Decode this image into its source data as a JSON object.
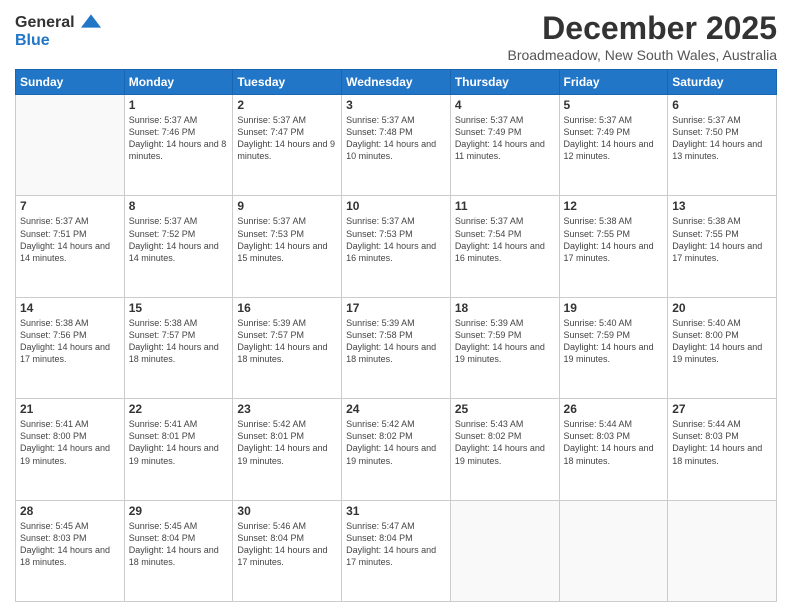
{
  "logo": {
    "line1": "General",
    "line2": "Blue"
  },
  "title": "December 2025",
  "subtitle": "Broadmeadow, New South Wales, Australia",
  "days_header": [
    "Sunday",
    "Monday",
    "Tuesday",
    "Wednesday",
    "Thursday",
    "Friday",
    "Saturday"
  ],
  "weeks": [
    [
      {
        "num": "",
        "sunrise": "",
        "sunset": "",
        "daylight": ""
      },
      {
        "num": "1",
        "sunrise": "Sunrise: 5:37 AM",
        "sunset": "Sunset: 7:46 PM",
        "daylight": "Daylight: 14 hours and 8 minutes."
      },
      {
        "num": "2",
        "sunrise": "Sunrise: 5:37 AM",
        "sunset": "Sunset: 7:47 PM",
        "daylight": "Daylight: 14 hours and 9 minutes."
      },
      {
        "num": "3",
        "sunrise": "Sunrise: 5:37 AM",
        "sunset": "Sunset: 7:48 PM",
        "daylight": "Daylight: 14 hours and 10 minutes."
      },
      {
        "num": "4",
        "sunrise": "Sunrise: 5:37 AM",
        "sunset": "Sunset: 7:49 PM",
        "daylight": "Daylight: 14 hours and 11 minutes."
      },
      {
        "num": "5",
        "sunrise": "Sunrise: 5:37 AM",
        "sunset": "Sunset: 7:49 PM",
        "daylight": "Daylight: 14 hours and 12 minutes."
      },
      {
        "num": "6",
        "sunrise": "Sunrise: 5:37 AM",
        "sunset": "Sunset: 7:50 PM",
        "daylight": "Daylight: 14 hours and 13 minutes."
      }
    ],
    [
      {
        "num": "7",
        "sunrise": "Sunrise: 5:37 AM",
        "sunset": "Sunset: 7:51 PM",
        "daylight": "Daylight: 14 hours and 14 minutes."
      },
      {
        "num": "8",
        "sunrise": "Sunrise: 5:37 AM",
        "sunset": "Sunset: 7:52 PM",
        "daylight": "Daylight: 14 hours and 14 minutes."
      },
      {
        "num": "9",
        "sunrise": "Sunrise: 5:37 AM",
        "sunset": "Sunset: 7:53 PM",
        "daylight": "Daylight: 14 hours and 15 minutes."
      },
      {
        "num": "10",
        "sunrise": "Sunrise: 5:37 AM",
        "sunset": "Sunset: 7:53 PM",
        "daylight": "Daylight: 14 hours and 16 minutes."
      },
      {
        "num": "11",
        "sunrise": "Sunrise: 5:37 AM",
        "sunset": "Sunset: 7:54 PM",
        "daylight": "Daylight: 14 hours and 16 minutes."
      },
      {
        "num": "12",
        "sunrise": "Sunrise: 5:38 AM",
        "sunset": "Sunset: 7:55 PM",
        "daylight": "Daylight: 14 hours and 17 minutes."
      },
      {
        "num": "13",
        "sunrise": "Sunrise: 5:38 AM",
        "sunset": "Sunset: 7:55 PM",
        "daylight": "Daylight: 14 hours and 17 minutes."
      }
    ],
    [
      {
        "num": "14",
        "sunrise": "Sunrise: 5:38 AM",
        "sunset": "Sunset: 7:56 PM",
        "daylight": "Daylight: 14 hours and 17 minutes."
      },
      {
        "num": "15",
        "sunrise": "Sunrise: 5:38 AM",
        "sunset": "Sunset: 7:57 PM",
        "daylight": "Daylight: 14 hours and 18 minutes."
      },
      {
        "num": "16",
        "sunrise": "Sunrise: 5:39 AM",
        "sunset": "Sunset: 7:57 PM",
        "daylight": "Daylight: 14 hours and 18 minutes."
      },
      {
        "num": "17",
        "sunrise": "Sunrise: 5:39 AM",
        "sunset": "Sunset: 7:58 PM",
        "daylight": "Daylight: 14 hours and 18 minutes."
      },
      {
        "num": "18",
        "sunrise": "Sunrise: 5:39 AM",
        "sunset": "Sunset: 7:59 PM",
        "daylight": "Daylight: 14 hours and 19 minutes."
      },
      {
        "num": "19",
        "sunrise": "Sunrise: 5:40 AM",
        "sunset": "Sunset: 7:59 PM",
        "daylight": "Daylight: 14 hours and 19 minutes."
      },
      {
        "num": "20",
        "sunrise": "Sunrise: 5:40 AM",
        "sunset": "Sunset: 8:00 PM",
        "daylight": "Daylight: 14 hours and 19 minutes."
      }
    ],
    [
      {
        "num": "21",
        "sunrise": "Sunrise: 5:41 AM",
        "sunset": "Sunset: 8:00 PM",
        "daylight": "Daylight: 14 hours and 19 minutes."
      },
      {
        "num": "22",
        "sunrise": "Sunrise: 5:41 AM",
        "sunset": "Sunset: 8:01 PM",
        "daylight": "Daylight: 14 hours and 19 minutes."
      },
      {
        "num": "23",
        "sunrise": "Sunrise: 5:42 AM",
        "sunset": "Sunset: 8:01 PM",
        "daylight": "Daylight: 14 hours and 19 minutes."
      },
      {
        "num": "24",
        "sunrise": "Sunrise: 5:42 AM",
        "sunset": "Sunset: 8:02 PM",
        "daylight": "Daylight: 14 hours and 19 minutes."
      },
      {
        "num": "25",
        "sunrise": "Sunrise: 5:43 AM",
        "sunset": "Sunset: 8:02 PM",
        "daylight": "Daylight: 14 hours and 19 minutes."
      },
      {
        "num": "26",
        "sunrise": "Sunrise: 5:44 AM",
        "sunset": "Sunset: 8:03 PM",
        "daylight": "Daylight: 14 hours and 18 minutes."
      },
      {
        "num": "27",
        "sunrise": "Sunrise: 5:44 AM",
        "sunset": "Sunset: 8:03 PM",
        "daylight": "Daylight: 14 hours and 18 minutes."
      }
    ],
    [
      {
        "num": "28",
        "sunrise": "Sunrise: 5:45 AM",
        "sunset": "Sunset: 8:03 PM",
        "daylight": "Daylight: 14 hours and 18 minutes."
      },
      {
        "num": "29",
        "sunrise": "Sunrise: 5:45 AM",
        "sunset": "Sunset: 8:04 PM",
        "daylight": "Daylight: 14 hours and 18 minutes."
      },
      {
        "num": "30",
        "sunrise": "Sunrise: 5:46 AM",
        "sunset": "Sunset: 8:04 PM",
        "daylight": "Daylight: 14 hours and 17 minutes."
      },
      {
        "num": "31",
        "sunrise": "Sunrise: 5:47 AM",
        "sunset": "Sunset: 8:04 PM",
        "daylight": "Daylight: 14 hours and 17 minutes."
      },
      {
        "num": "",
        "sunrise": "",
        "sunset": "",
        "daylight": ""
      },
      {
        "num": "",
        "sunrise": "",
        "sunset": "",
        "daylight": ""
      },
      {
        "num": "",
        "sunrise": "",
        "sunset": "",
        "daylight": ""
      }
    ]
  ]
}
